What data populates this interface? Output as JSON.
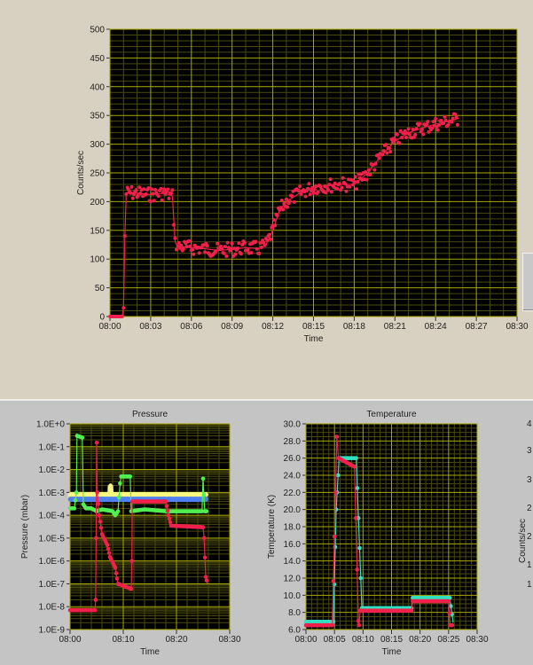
{
  "colors": {
    "plot_bg": "#000000",
    "grid_major": "#a8a800",
    "grid_minor": "#4a4a10",
    "red": "#f0204a",
    "green": "#50f050",
    "yellow": "#f8f880",
    "blue": "#5080f0",
    "cyan": "#30e0c0"
  },
  "partial_chart": {
    "ylabel": "Counts/sec",
    "ticks": [
      "4",
      "3",
      "3",
      "2",
      "2",
      "1",
      "1"
    ]
  },
  "chart_data": [
    {
      "type": "scatter",
      "title": "",
      "xlabel": "Time",
      "ylabel": "Counts/sec",
      "xlim": [
        0,
        30
      ],
      "ylim": [
        0,
        500
      ],
      "scale": "linear",
      "xticks": [
        "08:00",
        "08:03",
        "08:06",
        "08:09",
        "08:12",
        "08:15",
        "08:18",
        "08:21",
        "08:24",
        "08:27",
        "08:30"
      ],
      "yticks": [
        "0",
        "50",
        "100",
        "150",
        "200",
        "250",
        "300",
        "350",
        "400",
        "450",
        "500"
      ],
      "series": [
        {
          "name": "counts",
          "color": "red",
          "x": [
            0,
            0.9,
            1.0,
            1.1,
            1.2,
            2,
            3,
            4,
            4.6,
            4.8,
            5,
            6,
            7,
            8,
            9,
            10,
            11,
            11.5,
            12,
            12.5,
            13,
            14,
            15,
            16,
            17,
            18,
            19,
            20,
            21,
            22,
            23,
            24,
            25,
            25.7
          ],
          "y": [
            0,
            0,
            15,
            140,
            215,
            215,
            212,
            215,
            210,
            130,
            122,
            120,
            118,
            115,
            117,
            120,
            118,
            125,
            150,
            185,
            200,
            215,
            225,
            228,
            230,
            230,
            250,
            280,
            305,
            320,
            328,
            335,
            340,
            345
          ]
        }
      ]
    },
    {
      "type": "scatter",
      "title": "Pressure",
      "xlabel": "Time",
      "ylabel": "Pressure (mbar)",
      "xlim": [
        0,
        30
      ],
      "ylim": [
        1e-09,
        1
      ],
      "scale": "log",
      "xticks": [
        "08:00",
        "08:10",
        "08:20",
        "08:30"
      ],
      "yticks": [
        "1.0E-9",
        "1.0E-8",
        "1.0E-7",
        "1.0E-6",
        "1.0E-5",
        "1.0E-4",
        "1.0E-3",
        "1.0E-2",
        "1.0E-1",
        "1.0E+0"
      ],
      "series": [
        {
          "name": "yellow",
          "color": "yellow",
          "x": [
            0,
            7.5,
            7.6,
            7.7,
            25.8
          ],
          "y": [
            0.0008,
            0.0008,
            0.002,
            0.0008,
            0.0008
          ]
        },
        {
          "name": "blue",
          "color": "blue",
          "x": [
            0,
            25.8
          ],
          "y": [
            0.0005,
            0.0005
          ]
        },
        {
          "name": "green",
          "color": "green",
          "x": [
            0,
            0.8,
            1.2,
            1.3,
            2.3,
            2.5,
            3,
            4,
            5,
            6,
            8,
            8.5,
            9,
            9.4,
            9.6,
            11.3,
            11.5,
            14,
            18,
            24.8,
            25,
            25.3,
            25.8
          ],
          "y": [
            0.0002,
            0.0002,
            0.001,
            0.3,
            0.25,
            0.0003,
            0.0002,
            0.0002,
            0.00015,
            0.00018,
            0.00015,
            0.0001,
            0.00015,
            0.0025,
            0.005,
            0.005,
            0.00015,
            0.00018,
            0.00015,
            0.00015,
            0.004,
            0.00015,
            0.00015
          ]
        },
        {
          "name": "red",
          "color": "red",
          "x": [
            0,
            4.7,
            4.8,
            4.9,
            5.0,
            5.1,
            5.5,
            6,
            7,
            7.5,
            8.5,
            9,
            11.5,
            11.6,
            11.7,
            18,
            18.5,
            19,
            25,
            25.2,
            25.5,
            25.8
          ],
          "y": [
            7e-09,
            7e-09,
            2e-08,
            1e-05,
            0.15,
            0.001,
            0.0001,
            1.5e-05,
            5e-06,
            1.5e-06,
            5e-07,
            1e-07,
            6e-08,
            1e-06,
            0.0004,
            0.0004,
            0.0001,
            3.5e-05,
            3e-05,
            1e-05,
            2e-07,
            1e-07
          ]
        }
      ]
    },
    {
      "type": "scatter",
      "title": "Temperature",
      "xlabel": "Time",
      "ylabel": "Temperature (K)",
      "xlim": [
        0,
        30
      ],
      "ylim": [
        6,
        30
      ],
      "scale": "linear",
      "xticks": [
        "08:00",
        "08:05",
        "08:10",
        "08:15",
        "08:20",
        "08:25",
        "08:30"
      ],
      "yticks": [
        "6.0",
        "8.0",
        "10.0",
        "12.0",
        "14.0",
        "16.0",
        "18.0",
        "20.0",
        "22.0",
        "24.0",
        "26.0",
        "28.0",
        "30.0"
      ],
      "series": [
        {
          "name": "cyan",
          "color": "cyan",
          "x": [
            0,
            4.8,
            5.3,
            5.8,
            8.8,
            9.8,
            10,
            18.5,
            18.7,
            25.2,
            25.8
          ],
          "y": [
            6.9,
            6.9,
            20,
            26,
            26,
            8.5,
            8.5,
            8.5,
            9.7,
            9.7,
            6.8
          ]
        },
        {
          "name": "red",
          "color": "red",
          "x": [
            0,
            4.6,
            5.2,
            5.4,
            5.7,
            8.5,
            9.2,
            9.3,
            9.5,
            18.5,
            18.7,
            25,
            25.3,
            25.8
          ],
          "y": [
            6.5,
            6.5,
            22,
            28.5,
            26,
            25,
            7,
            6.5,
            8.2,
            8.2,
            9.3,
            9.3,
            6.5,
            6.5
          ]
        }
      ]
    }
  ]
}
